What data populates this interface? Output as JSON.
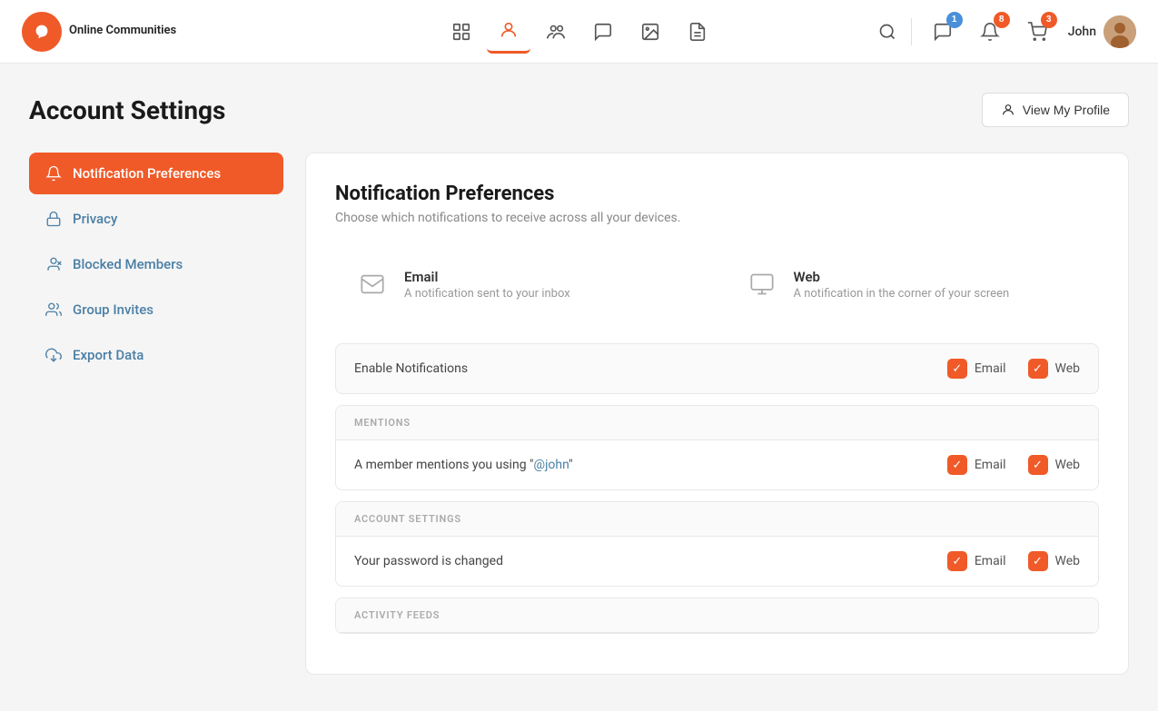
{
  "app": {
    "logo_letter": "b",
    "brand_name": "Online\nCommunities"
  },
  "topnav": {
    "nav_icons": [
      {
        "name": "dashboard-icon",
        "label": "Dashboard",
        "active": false
      },
      {
        "name": "profile-icon",
        "label": "Profile",
        "active": true
      },
      {
        "name": "groups-icon",
        "label": "Groups",
        "active": false
      },
      {
        "name": "messages-icon",
        "label": "Messages",
        "active": false
      },
      {
        "name": "media-icon",
        "label": "Media",
        "active": false
      },
      {
        "name": "documents-icon",
        "label": "Documents",
        "active": false
      }
    ],
    "badges": [
      {
        "name": "messages-badge",
        "count": "1",
        "color": "badge-blue"
      },
      {
        "name": "notifications-badge",
        "count": "8",
        "color": "badge-orange"
      },
      {
        "name": "cart-badge",
        "count": "3",
        "color": "badge-orange"
      }
    ],
    "user_name": "John"
  },
  "page": {
    "title": "Account Settings",
    "view_profile_btn": "View My Profile"
  },
  "sidebar": {
    "items": [
      {
        "id": "notification-preferences",
        "label": "Notification Preferences",
        "active": true,
        "icon": "bell-icon"
      },
      {
        "id": "privacy",
        "label": "Privacy",
        "active": false,
        "icon": "lock-icon"
      },
      {
        "id": "blocked-members",
        "label": "Blocked Members",
        "active": false,
        "icon": "user-block-icon"
      },
      {
        "id": "group-invites",
        "label": "Group Invites",
        "active": false,
        "icon": "users-icon"
      },
      {
        "id": "export-data",
        "label": "Export Data",
        "active": false,
        "icon": "cloud-icon"
      }
    ]
  },
  "main": {
    "section_title": "Notification Preferences",
    "section_desc": "Choose which notifications to receive across all your devices.",
    "channels": [
      {
        "id": "email",
        "name": "Email",
        "desc": "A notification sent to your inbox",
        "icon": "email-icon"
      },
      {
        "id": "web",
        "name": "Web",
        "desc": "A notification in the corner of your screen",
        "icon": "monitor-icon"
      }
    ],
    "enable_row": {
      "label": "Enable Notifications",
      "email_checked": true,
      "web_checked": true
    },
    "groups": [
      {
        "id": "mentions",
        "header": "MENTIONS",
        "rows": [
          {
            "id": "member-mention",
            "label": "A member mentions you using \"@john\"",
            "email_checked": true,
            "web_checked": true
          }
        ]
      },
      {
        "id": "account-settings",
        "header": "ACCOUNT SETTINGS",
        "rows": [
          {
            "id": "password-changed",
            "label": "Your password is changed",
            "email_checked": true,
            "web_checked": true
          }
        ]
      },
      {
        "id": "activity-feeds",
        "header": "ACTIVITY FEEDS",
        "rows": []
      }
    ]
  }
}
